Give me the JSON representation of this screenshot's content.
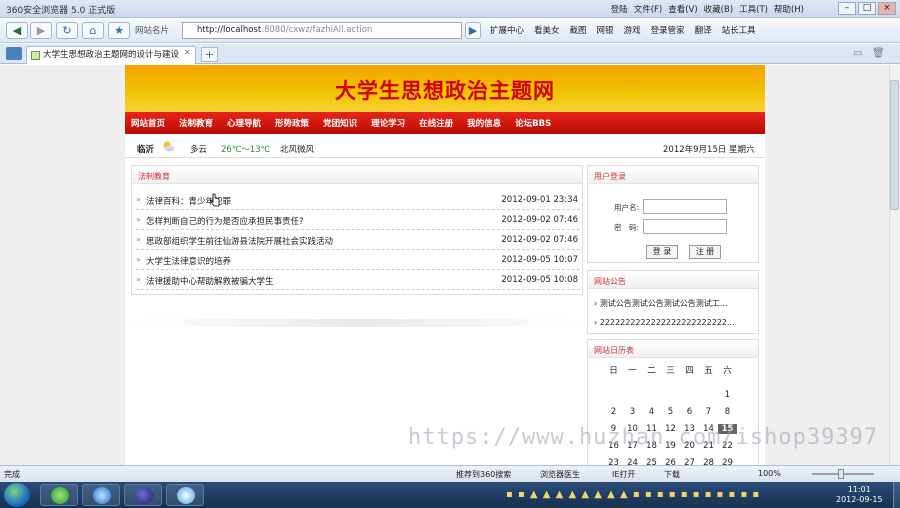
{
  "browser": {
    "title": "360安全浏览器 5.0 正式版",
    "menus": [
      "登陆",
      "文件(F)",
      "查看(V)",
      "收藏(B)",
      "工具(T)",
      "帮助(H)"
    ],
    "window_controls": [
      "–",
      "□",
      "×"
    ],
    "favorites_label": "网站名片",
    "url_host": "http://localhost",
    "url_rest": ":8080/cxwz/fazhiAll.action",
    "toolbar_items": [
      "扩展中心",
      "看美女",
      "截图",
      "网银",
      "游戏",
      "登录管家",
      "翻译",
      "站长工具"
    ],
    "tab_title": "大学生思想政治主题网的设计与建设",
    "status_left": "完成",
    "status_items": [
      "推荐到360搜索",
      "浏览器医生",
      "IE打开",
      "下载",
      "100%"
    ]
  },
  "site": {
    "title": "大学生思想政治主题网",
    "nav": [
      "网站首页",
      "法制教育",
      "心理导航",
      "形势政策",
      "党团知识",
      "理论学习",
      "在线注册",
      "我的信息",
      "论坛BBS"
    ],
    "weather": {
      "city": "临沂",
      "condition": "多云",
      "temp": "26℃～13℃",
      "wind": "北风微风"
    },
    "date": "2012年9月15日 星期六"
  },
  "law_section": {
    "title": "法制教育",
    "items": [
      {
        "title": "法律百科：青少年犯罪",
        "date": "2012-09-01 23:34"
      },
      {
        "title": "怎样判断自己的行为是否应承担民事责任?",
        "date": "2012-09-02 07:46"
      },
      {
        "title": "思政部组织学生前往仙游县法院开展社会实践活动",
        "date": "2012-09-02 07:46"
      },
      {
        "title": "大学生法律意识的培养",
        "date": "2012-09-05 10:07"
      },
      {
        "title": "法律援助中心帮助解救被骗大学生",
        "date": "2012-09-05 10:08"
      }
    ]
  },
  "login": {
    "title": "用户登录",
    "username_label": "用户名:",
    "password_label": "密　码:",
    "login_button": "登 录",
    "register_button": "注 册"
  },
  "announcements": {
    "title": "网站公告",
    "items": [
      "测试公告测试公告测试公告测试工...",
      "2222222222222222222222222..."
    ]
  },
  "calendar": {
    "title": "网站日历表",
    "weekdays": [
      "日",
      "一",
      "二",
      "三",
      "四",
      "五",
      "六"
    ],
    "rows": [
      [
        "",
        "",
        "",
        "",
        "",
        "",
        "1"
      ],
      [
        "2",
        "3",
        "4",
        "5",
        "6",
        "7",
        "8"
      ],
      [
        "9",
        "10",
        "11",
        "12",
        "13",
        "14",
        "15"
      ],
      [
        "16",
        "17",
        "18",
        "19",
        "20",
        "21",
        "22"
      ],
      [
        "23",
        "24",
        "25",
        "26",
        "27",
        "28",
        "29"
      ]
    ],
    "today": "15"
  },
  "watermark": "https://www.huzhan.com/ishop39397",
  "taskbar": {
    "time": "11:01",
    "date": "2012-09-15"
  }
}
